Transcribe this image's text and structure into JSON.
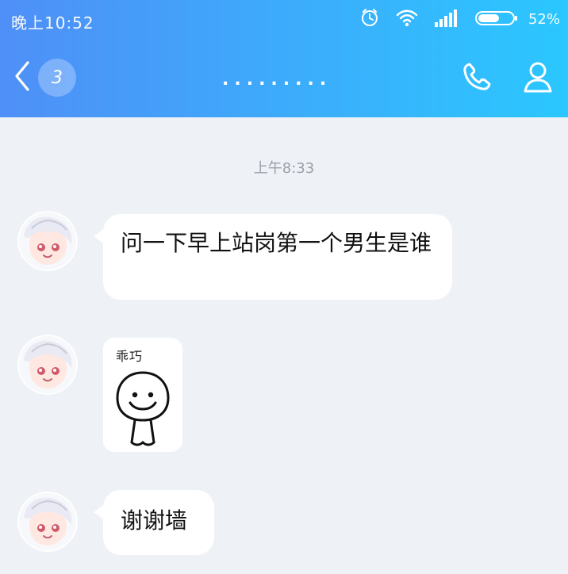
{
  "status_bar": {
    "time": "晚上10:52",
    "battery_percent": "52%",
    "icons": [
      "alarm-icon",
      "wifi-icon",
      "signal-icon",
      "battery-icon"
    ]
  },
  "header": {
    "back_icon": "chevron-left-icon",
    "unread_count": "3",
    "title": ".........",
    "actions": [
      "phone-icon",
      "profile-icon"
    ],
    "gradient": [
      "#4f8ff7",
      "#2bc7ff"
    ]
  },
  "chat": {
    "timestamp": "上午8:33",
    "messages": [
      {
        "type": "text",
        "text": "问一下早上站岗第一个男生是谁"
      },
      {
        "type": "sticker",
        "caption": "乖巧",
        "icon": "cute-sticker-icon"
      },
      {
        "type": "text",
        "text": "谢谢墙"
      }
    ]
  },
  "colors": {
    "chat_bg": "#eef1f6",
    "bubble_bg": "#ffffff",
    "timestamp": "#9aa0aa"
  }
}
